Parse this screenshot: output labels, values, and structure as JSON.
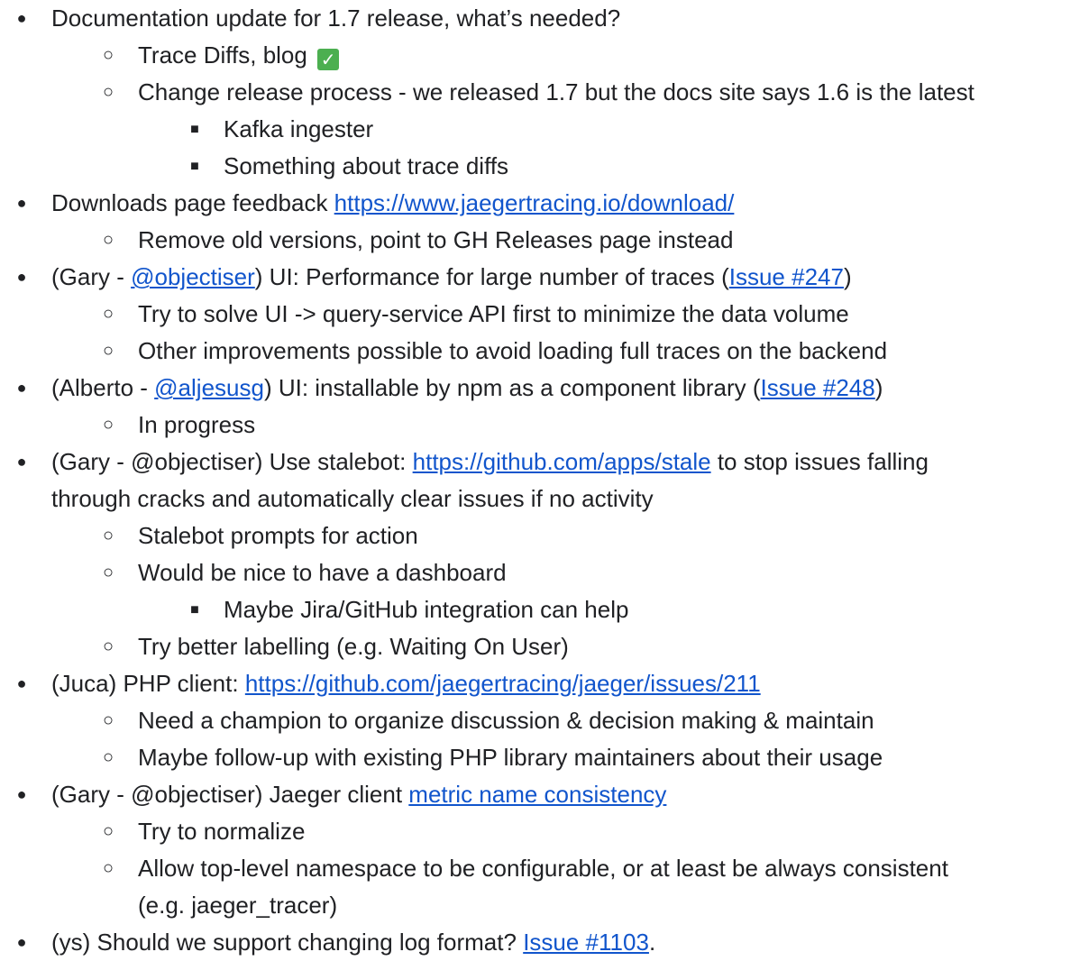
{
  "items": [
    {
      "id": "r1",
      "level": 1,
      "parts": [
        {
          "t": "Documentation update for 1.7 release, what’s needed?"
        }
      ]
    },
    {
      "id": "r2",
      "level": 2,
      "parts": [
        {
          "t": "Trace Diffs, blog "
        }
      ],
      "check": true
    },
    {
      "id": "r3",
      "level": 2,
      "parts": [
        {
          "t": "Change release process - we released 1.7 but the docs site says 1.6 is the latest"
        }
      ]
    },
    {
      "id": "r4",
      "level": 3,
      "parts": [
        {
          "t": "Kafka ingester"
        }
      ]
    },
    {
      "id": "r5",
      "level": 3,
      "parts": [
        {
          "t": "Something about trace diffs"
        }
      ]
    },
    {
      "id": "r6",
      "level": 1,
      "parts": [
        {
          "t": "Downloads page feedback "
        },
        {
          "t": "https://www.jaegertracing.io/download/",
          "link": true
        }
      ]
    },
    {
      "id": "r7",
      "level": 2,
      "parts": [
        {
          "t": "Remove old versions, point to GH Releases page instead"
        }
      ]
    },
    {
      "id": "r8",
      "level": 1,
      "parts": [
        {
          "t": "(Gary - "
        },
        {
          "t": "@objectiser",
          "link": true
        },
        {
          "t": ") UI: Performance for large number of traces ("
        },
        {
          "t": "Issue #247",
          "link": true
        },
        {
          "t": ")"
        }
      ]
    },
    {
      "id": "r9",
      "level": 2,
      "parts": [
        {
          "t": "Try to solve UI -> query-service API first to minimize the data volume"
        }
      ]
    },
    {
      "id": "r10",
      "level": 2,
      "parts": [
        {
          "t": "Other improvements possible to avoid loading full traces on the backend"
        }
      ]
    },
    {
      "id": "r11",
      "level": 1,
      "parts": [
        {
          "t": "(Alberto - "
        },
        {
          "t": "@aljesusg",
          "link": true
        },
        {
          "t": ") UI: installable by npm as a component library ("
        },
        {
          "t": "Issue #248",
          "link": true
        },
        {
          "t": ")"
        }
      ]
    },
    {
      "id": "r12",
      "level": 2,
      "parts": [
        {
          "t": "In progress"
        }
      ]
    },
    {
      "id": "r13",
      "level": 1,
      "parts": [
        {
          "t": "(Gary - @objectiser) Use stalebot: "
        },
        {
          "t": "https://github.com/apps/stale",
          "link": true
        },
        {
          "t": " to stop issues falling"
        }
      ]
    },
    {
      "id": "r14",
      "level": 0,
      "parts": [
        {
          "t": "through cracks and automatically clear issues if no activity"
        }
      ]
    },
    {
      "id": "r15",
      "level": 2,
      "parts": [
        {
          "t": "Stalebot prompts for action"
        }
      ]
    },
    {
      "id": "r16",
      "level": 2,
      "parts": [
        {
          "t": "Would be nice to have a dashboard"
        }
      ]
    },
    {
      "id": "r17",
      "level": 3,
      "parts": [
        {
          "t": "Maybe Jira/GitHub integration can help"
        }
      ]
    },
    {
      "id": "r18",
      "level": 2,
      "parts": [
        {
          "t": "Try better labelling (e.g. Waiting On User)"
        }
      ]
    },
    {
      "id": "r19",
      "level": 1,
      "parts": [
        {
          "t": "(Juca) PHP client: "
        },
        {
          "t": "https://github.com/jaegertracing/jaeger/issues/211",
          "link": true
        }
      ]
    },
    {
      "id": "r20",
      "level": 2,
      "parts": [
        {
          "t": "Need a champion to organize discussion & decision making & maintain"
        }
      ]
    },
    {
      "id": "r21",
      "level": 2,
      "parts": [
        {
          "t": "Maybe follow-up with existing PHP library maintainers about their usage"
        }
      ]
    },
    {
      "id": "r22",
      "level": 1,
      "parts": [
        {
          "t": "(Gary - @objectiser) Jaeger client "
        },
        {
          "t": "metric name consistency",
          "link": true
        }
      ]
    },
    {
      "id": "r23",
      "level": 2,
      "parts": [
        {
          "t": "Try to normalize"
        }
      ]
    },
    {
      "id": "r24",
      "level": 2,
      "parts": [
        {
          "t": "Allow top-level namespace to be configurable, or at least be always consistent"
        }
      ]
    },
    {
      "id": "r25",
      "level": 4,
      "parts": [
        {
          "t": "(e.g. jaeger_tracer)"
        }
      ]
    },
    {
      "id": "r26",
      "level": 1,
      "parts": [
        {
          "t": "(ys) Should we support changing log format? "
        },
        {
          "t": "Issue #1103",
          "link": true
        },
        {
          "t": "."
        }
      ]
    }
  ],
  "bullets": {
    "level1": "●",
    "level2": "○",
    "level3": "■"
  },
  "colors": {
    "text": "#202124",
    "link": "#1155cc",
    "check": "#4caf50"
  },
  "check_icon": "check-mark-button-icon",
  "check_glyph": "✓"
}
